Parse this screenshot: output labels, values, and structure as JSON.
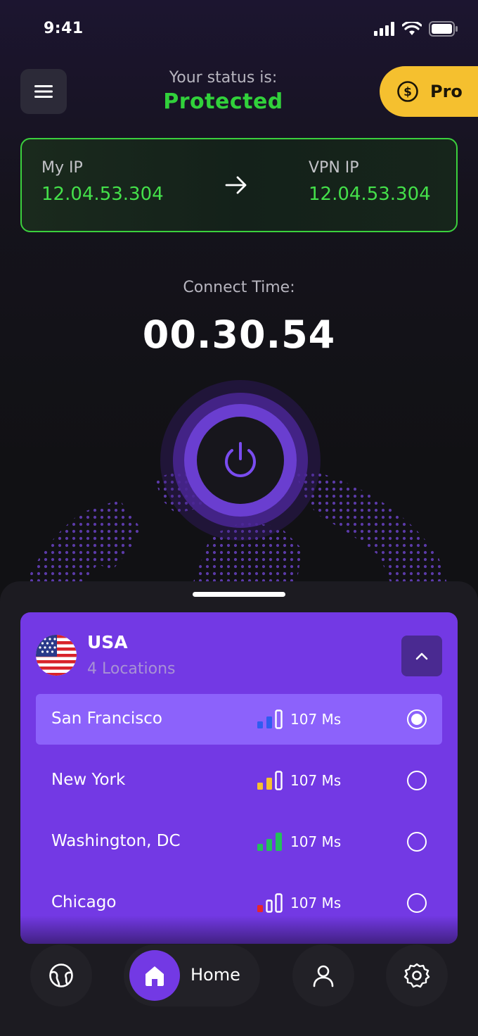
{
  "status_bar": {
    "time": "9:41"
  },
  "header": {
    "status_label": "Your status is:",
    "status_value": "Protected",
    "pro_label": "Pro"
  },
  "ip_card": {
    "my_ip_label": "My IP",
    "my_ip_value": "12.04.53.304",
    "vpn_ip_label": "VPN IP",
    "vpn_ip_value": "12.04.53.304"
  },
  "connection": {
    "label": "Connect Time:",
    "time": "00.30.54"
  },
  "country": {
    "name": "USA",
    "sub": "4 Locations",
    "locations": [
      {
        "name": "San Francisco",
        "ping": "107 Ms",
        "signal_color": "#2f5cf0",
        "signal_level": 2,
        "selected": true
      },
      {
        "name": "New York",
        "ping": "107 Ms",
        "signal_color": "#f5c02f",
        "signal_level": 2,
        "selected": false
      },
      {
        "name": "Washington, DC",
        "ping": "107 Ms",
        "signal_color": "#24c05a",
        "signal_level": 3,
        "selected": false
      },
      {
        "name": "Chicago",
        "ping": "107 Ms",
        "signal_color": "#e8262b",
        "signal_level": 1,
        "selected": false
      }
    ]
  },
  "nav": {
    "home_label": "Home",
    "icons": [
      "globe-icon",
      "home-icon",
      "user-icon",
      "settings-icon"
    ]
  },
  "colors": {
    "accent": "#7339e4",
    "protected_green": "#31d13b",
    "pro_yellow": "#f5c02f"
  }
}
